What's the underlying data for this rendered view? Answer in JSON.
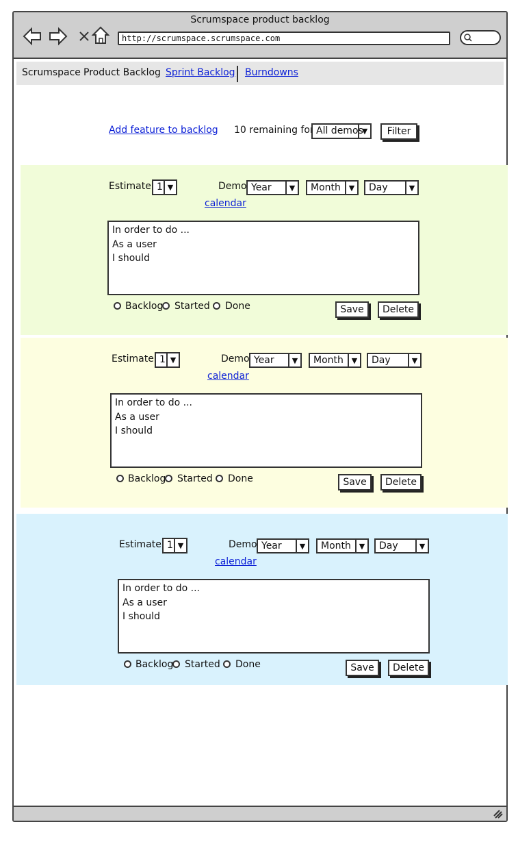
{
  "window": {
    "title": "Scrumspace product backlog",
    "url": "http://scrumspace.scrumspace.com"
  },
  "nav": {
    "items": [
      {
        "label": "Scrumspace"
      },
      {
        "label": "Product Backlog"
      },
      {
        "label": "Sprint Backlog"
      },
      {
        "label": "Burndowns"
      }
    ]
  },
  "toolbar": {
    "add_feature": "Add feature to backlog",
    "remaining_text": "10 remaining for",
    "demo_filter_value": "All demos",
    "filter_label": "Filter"
  },
  "cards": [
    {
      "background": "#f1fcd9",
      "estimate_label": "Estimate:",
      "estimate_value": "1",
      "demo_label": "Demo:",
      "year": "Year",
      "month": "Month",
      "day": "Day",
      "calendar": "calendar",
      "story": [
        "In order to do ...",
        "As a user",
        "I should"
      ],
      "status": [
        "Backlog",
        "Started",
        "Done"
      ],
      "save": "Save",
      "delete": "Delete"
    },
    {
      "background": "#fdfee0",
      "estimate_label": "Estimate:",
      "estimate_value": "1",
      "demo_label": "Demo:",
      "year": "Year",
      "month": "Month",
      "day": "Day",
      "calendar": "calendar",
      "story": [
        "In order to do ...",
        "As a user",
        "I should"
      ],
      "status": [
        "Backlog",
        "Started",
        "Done"
      ],
      "save": "Save",
      "delete": "Delete"
    },
    {
      "background": "#d9f2fd",
      "estimate_label": "Estimate:",
      "estimate_value": "1",
      "demo_label": "Demo:",
      "year": "Year",
      "month": "Month",
      "day": "Day",
      "calendar": "calendar",
      "story": [
        "In order to do ...",
        "As a user",
        "I should"
      ],
      "status": [
        "Backlog",
        "Started",
        "Done"
      ],
      "save": "Save",
      "delete": "Delete"
    }
  ]
}
